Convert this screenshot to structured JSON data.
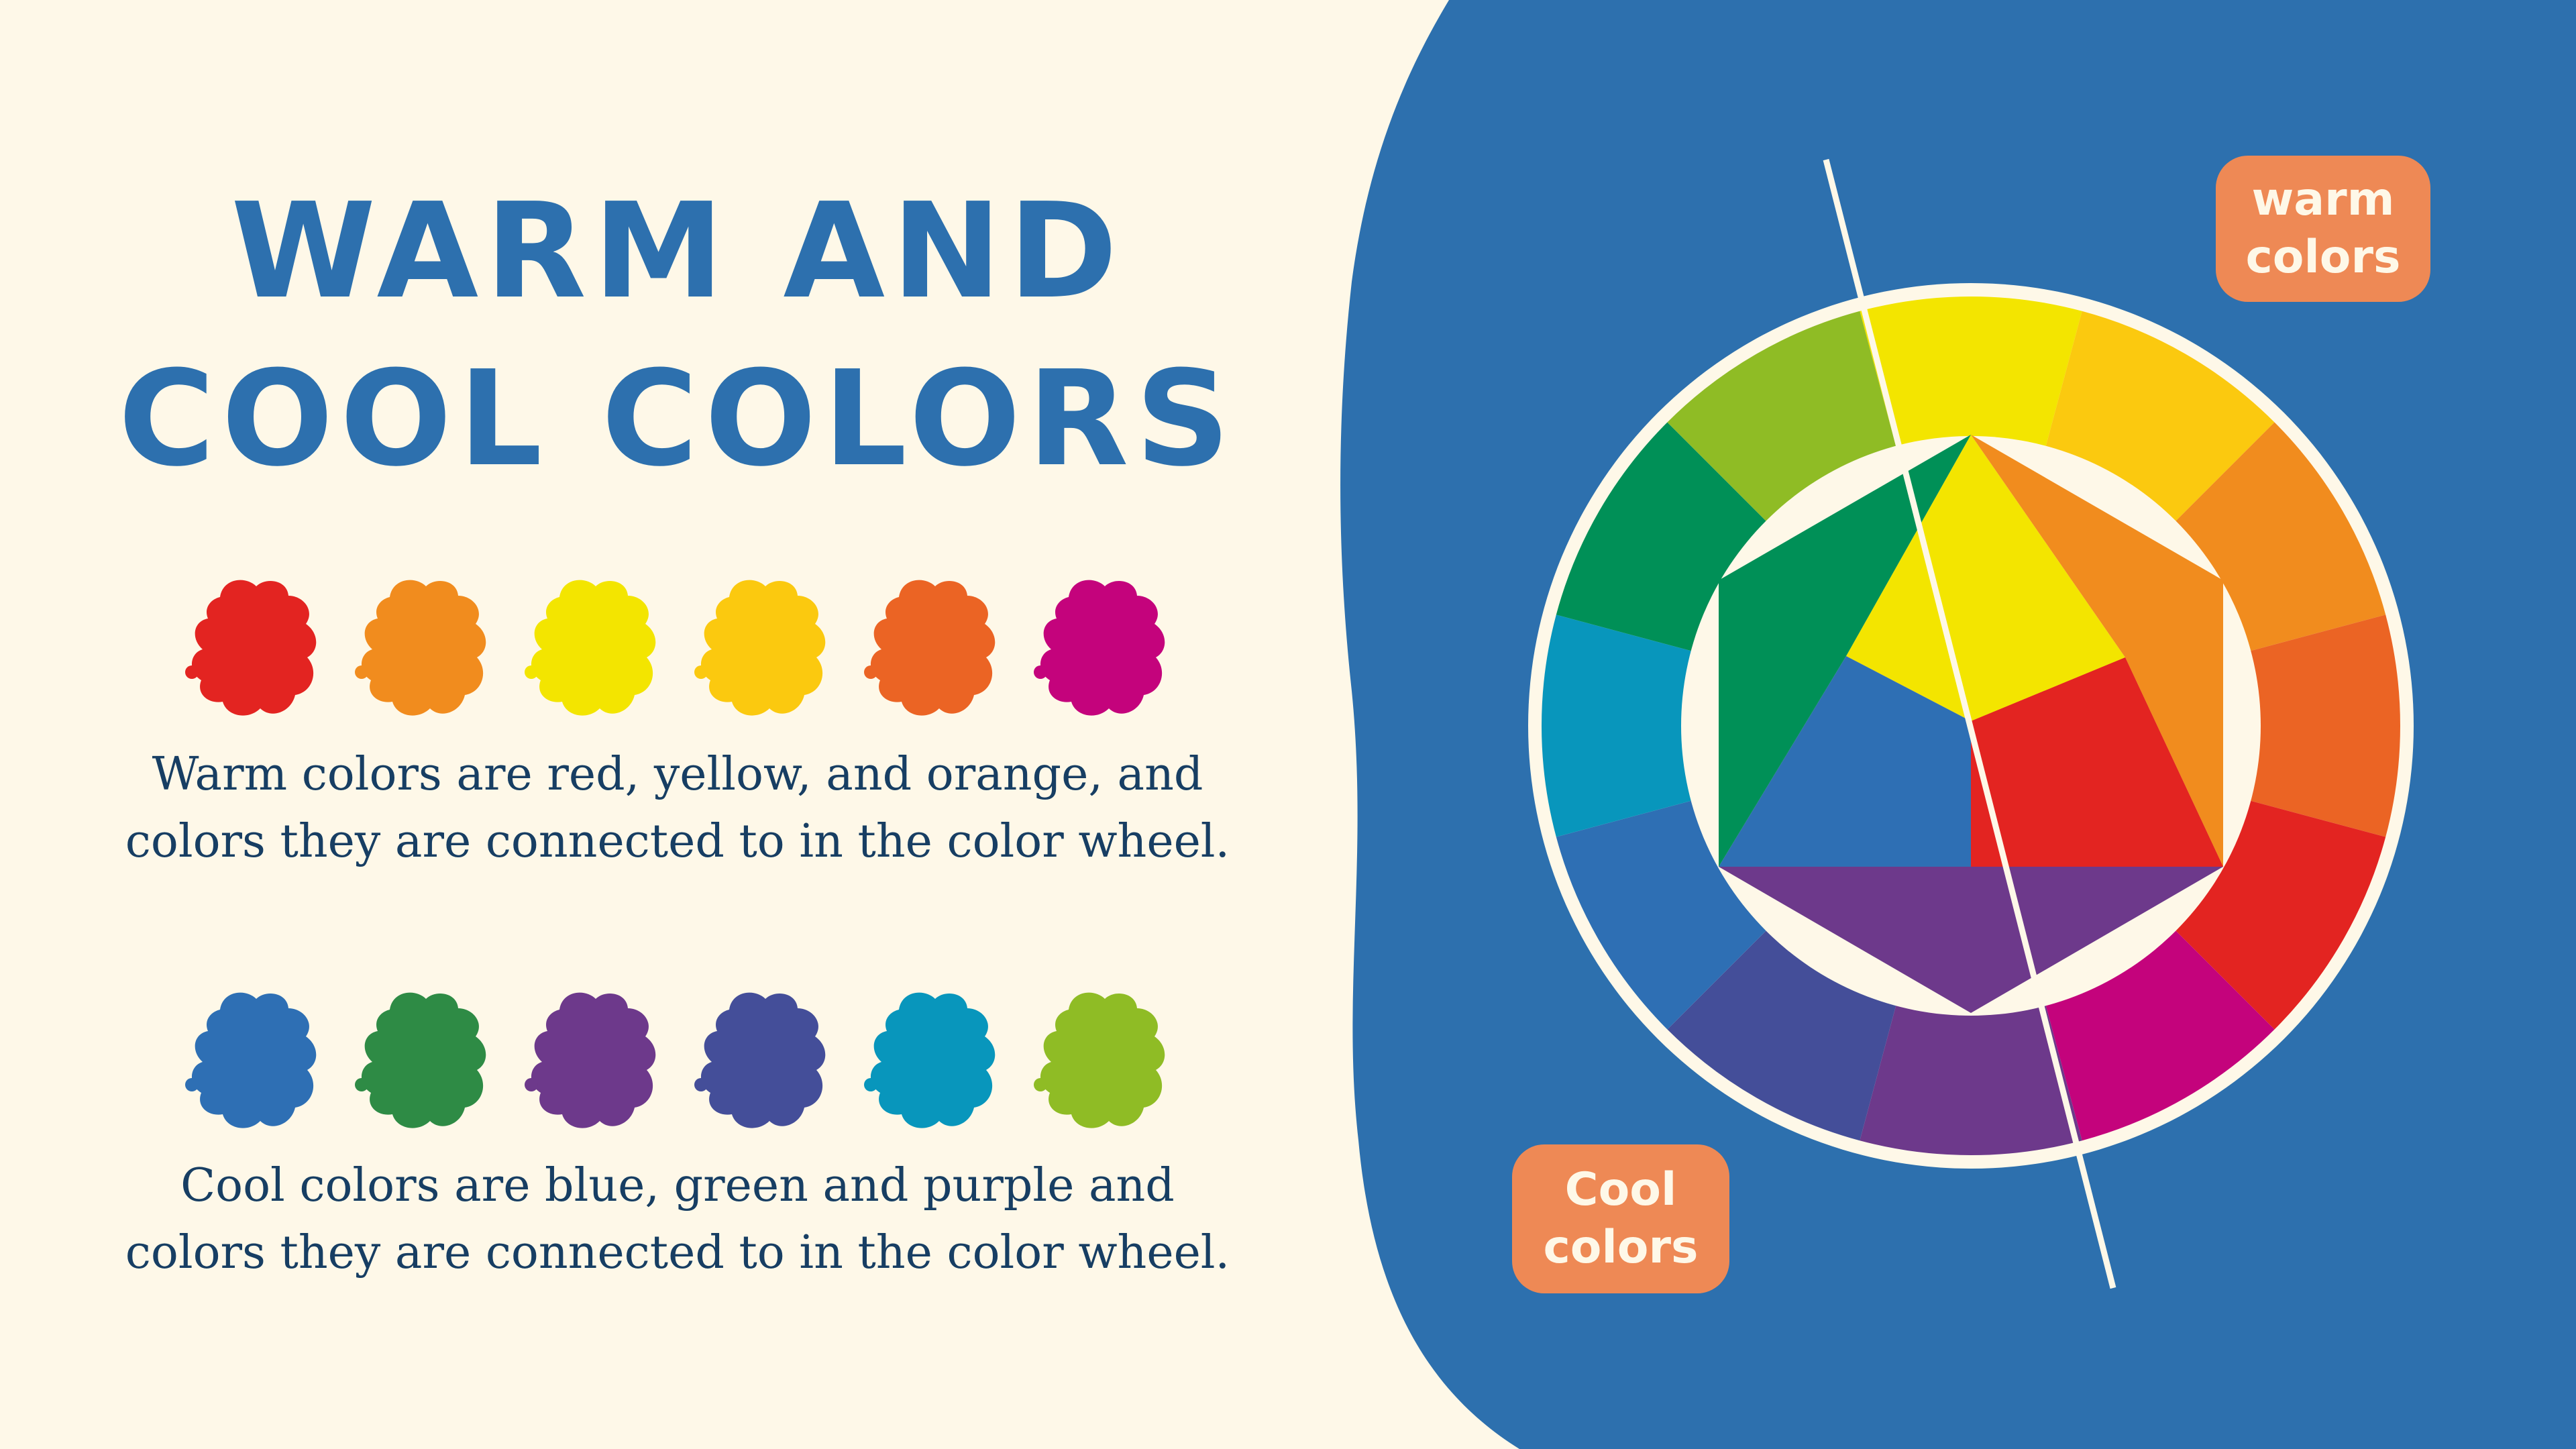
{
  "title": {
    "line1": "WARM AND",
    "line2": "COOL COLORS"
  },
  "warm": {
    "swatches": [
      {
        "name": "red",
        "color": "#E32421"
      },
      {
        "name": "orange",
        "color": "#F18C1E"
      },
      {
        "name": "yellow",
        "color": "#F3E500"
      },
      {
        "name": "yellow-orange",
        "color": "#FBC90F"
      },
      {
        "name": "red-orange",
        "color": "#EB6424"
      },
      {
        "name": "magenta",
        "color": "#C4037C"
      }
    ],
    "description_line1": "Warm colors are red, yellow, and orange, and",
    "description_line2": "colors they are connected to in the color wheel."
  },
  "cool": {
    "swatches": [
      {
        "name": "blue",
        "color": "#2E6FB4"
      },
      {
        "name": "green",
        "color": "#2E8B45"
      },
      {
        "name": "purple",
        "color": "#6D398B"
      },
      {
        "name": "blue-violet",
        "color": "#444E99"
      },
      {
        "name": "cyan",
        "color": "#0896BC"
      },
      {
        "name": "yellow-green",
        "color": "#8FBC25"
      }
    ],
    "description_line1": "Cool colors are blue, green and purple and",
    "description_line2": "colors they are connected to in the color wheel."
  },
  "labels": {
    "warm_tag_line1": "warm",
    "warm_tag_line2": "colors",
    "cool_tag_line1": "Cool",
    "cool_tag_line2": "colors"
  },
  "colors": {
    "background": "#FEF8E8",
    "panel_blue": "#2D70AE",
    "title_blue": "#2D70AE",
    "text_dark": "#173E63",
    "tag_orange": "#EE8955"
  },
  "wheel": {
    "segments": [
      {
        "name": "yellow",
        "color": "#F3E500"
      },
      {
        "name": "yellow-orange",
        "color": "#FBC90F"
      },
      {
        "name": "orange",
        "color": "#F18C1E"
      },
      {
        "name": "red-orange",
        "color": "#EB6424"
      },
      {
        "name": "red",
        "color": "#E32421"
      },
      {
        "name": "red-violet",
        "color": "#C4037C"
      },
      {
        "name": "violet",
        "color": "#6D398B"
      },
      {
        "name": "blue-violet",
        "color": "#444E99"
      },
      {
        "name": "blue",
        "color": "#2E6FB4"
      },
      {
        "name": "blue-green",
        "color": "#0896BC"
      },
      {
        "name": "green",
        "color": "#009057"
      },
      {
        "name": "yellow-green",
        "color": "#8FBC25"
      }
    ],
    "primary": {
      "red": "#E32421",
      "yellow": "#F3E500",
      "blue": "#2E6FB4"
    },
    "secondary": {
      "orange": "#F18C1E",
      "green": "#009057",
      "violet": "#6D398B"
    }
  }
}
